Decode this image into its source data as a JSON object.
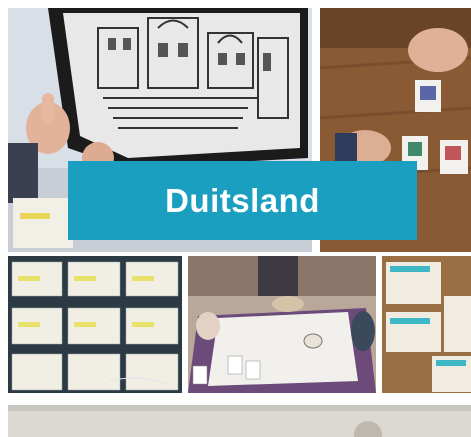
{
  "banner": {
    "label": "Duitsland",
    "background": "#1a9fc0",
    "text_color": "#ffffff"
  },
  "photos": [
    {
      "name": "escher-print-thumbs-up-photo"
    },
    {
      "name": "cards-on-table-thumbs-up-photo"
    },
    {
      "name": "worksheets-grid-photo"
    },
    {
      "name": "group-at-table-photo"
    },
    {
      "name": "worksheets-stack-photo"
    },
    {
      "name": "bottom-photo"
    }
  ]
}
